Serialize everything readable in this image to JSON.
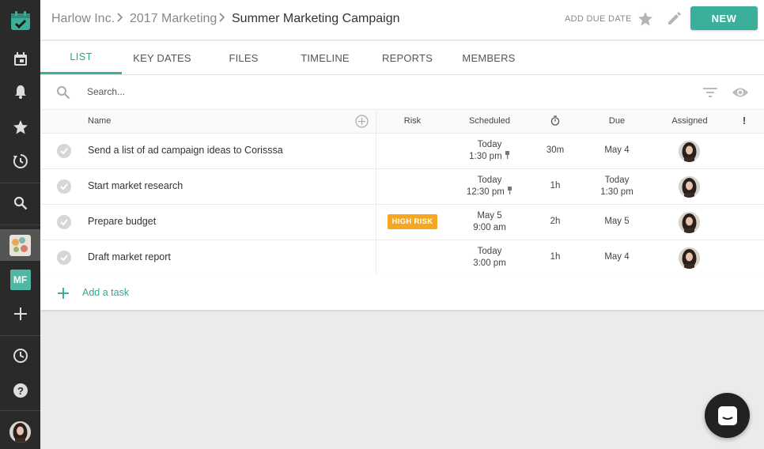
{
  "breadcrumb": {
    "org": "Harlow Inc.",
    "folder": "2017 Marketing",
    "project": "Summer Marketing Campaign"
  },
  "header": {
    "add_due_date": "ADD DUE DATE",
    "new_label": "NEW"
  },
  "tabs": [
    {
      "label": "LIST",
      "active": true
    },
    {
      "label": "KEY DATES"
    },
    {
      "label": "FILES"
    },
    {
      "label": "TIMELINE"
    },
    {
      "label": "REPORTS"
    },
    {
      "label": "MEMBERS"
    }
  ],
  "search": {
    "placeholder": "Search..."
  },
  "table": {
    "headers": {
      "name": "Name",
      "risk": "Risk",
      "scheduled": "Scheduled",
      "due": "Due",
      "assigned": "Assigned",
      "priority": "!"
    },
    "rows": [
      {
        "name": "Send a list of ad campaign ideas to Corisssa",
        "risk": "",
        "scheduled_1": "Today",
        "scheduled_2": "1:30 pm",
        "pinned": true,
        "duration": "30m",
        "due_1": "May 4",
        "due_2": ""
      },
      {
        "name": "Start market research",
        "risk": "",
        "scheduled_1": "Today",
        "scheduled_2": "12:30 pm",
        "pinned": true,
        "duration": "1h",
        "due_1": "Today",
        "due_2": "1:30 pm"
      },
      {
        "name": "Prepare budget",
        "risk": "HIGH RISK",
        "scheduled_1": "May 5",
        "scheduled_2": "9:00 am",
        "pinned": false,
        "duration": "2h",
        "due_1": "May 5",
        "due_2": ""
      },
      {
        "name": "Draft market report",
        "risk": "",
        "scheduled_1": "Today",
        "scheduled_2": "3:00 pm",
        "pinned": false,
        "duration": "1h",
        "due_1": "May 4",
        "due_2": ""
      }
    ],
    "add_task": "Add a task"
  },
  "sidebar": {
    "team_initials": "MF"
  },
  "colors": {
    "accent": "#3ab09b",
    "sidebar": "#2a2a2a",
    "risk_high": "#f5a623"
  }
}
